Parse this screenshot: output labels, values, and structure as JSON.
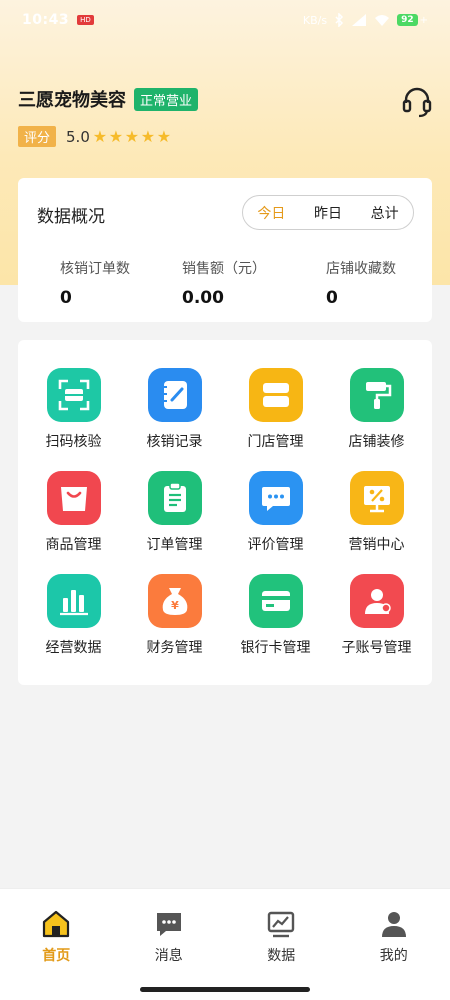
{
  "status_bar": {
    "time": "10:43",
    "hd_badge": "HD",
    "network": "KB/s",
    "battery": "92",
    "colors": {
      "battery": "#4cd964"
    }
  },
  "shop": {
    "name": "三愿宠物美容",
    "status_badge": "正常营业",
    "rating_label": "评分",
    "rating_score": "5.0",
    "stars": 5,
    "service_icon": "headset-icon"
  },
  "overview": {
    "title": "数据概况",
    "tabs": [
      {
        "label": "今日",
        "active": true
      },
      {
        "label": "昨日",
        "active": false
      },
      {
        "label": "总计",
        "active": false
      }
    ],
    "stats": [
      {
        "label": "核销订单数",
        "value": "0"
      },
      {
        "label": "销售额（元）",
        "value": "0.00"
      },
      {
        "label": "店铺收藏数",
        "value": "0"
      }
    ]
  },
  "functions": [
    {
      "label": "扫码核验",
      "icon": "scan-icon",
      "color": "#1ec8a5"
    },
    {
      "label": "核销记录",
      "icon": "notebook-icon",
      "color": "#2a8cf0"
    },
    {
      "label": "门店管理",
      "icon": "store-icon",
      "color": "#f7b614"
    },
    {
      "label": "店铺装修",
      "icon": "paint-roller-icon",
      "color": "#22c17a"
    },
    {
      "label": "商品管理",
      "icon": "shopping-bag-icon",
      "color": "#f1474f"
    },
    {
      "label": "订单管理",
      "icon": "clipboard-icon",
      "color": "#1fbf7a"
    },
    {
      "label": "评价管理",
      "icon": "chat-bubble-icon",
      "color": "#2b93f2"
    },
    {
      "label": "营销中心",
      "icon": "discount-icon",
      "color": "#f8b617"
    },
    {
      "label": "经营数据",
      "icon": "bar-chart-icon",
      "color": "#1cc7a9"
    },
    {
      "label": "财务管理",
      "icon": "money-bag-icon",
      "color": "#fb7b3d"
    },
    {
      "label": "银行卡管理",
      "icon": "bank-card-icon",
      "color": "#21c27c"
    },
    {
      "label": "子账号管理",
      "icon": "sub-account-icon",
      "color": "#f24a50"
    }
  ],
  "nav": [
    {
      "label": "首页",
      "icon": "home-icon",
      "active": true
    },
    {
      "label": "消息",
      "icon": "message-icon",
      "active": false
    },
    {
      "label": "数据",
      "icon": "data-icon",
      "active": false
    },
    {
      "label": "我的",
      "icon": "user-icon",
      "active": false
    }
  ],
  "colors": {
    "accent": "#e29a18",
    "open_badge": "#1fb36b",
    "rating_tag": "#f1b249",
    "star": "#f6bb2b"
  }
}
